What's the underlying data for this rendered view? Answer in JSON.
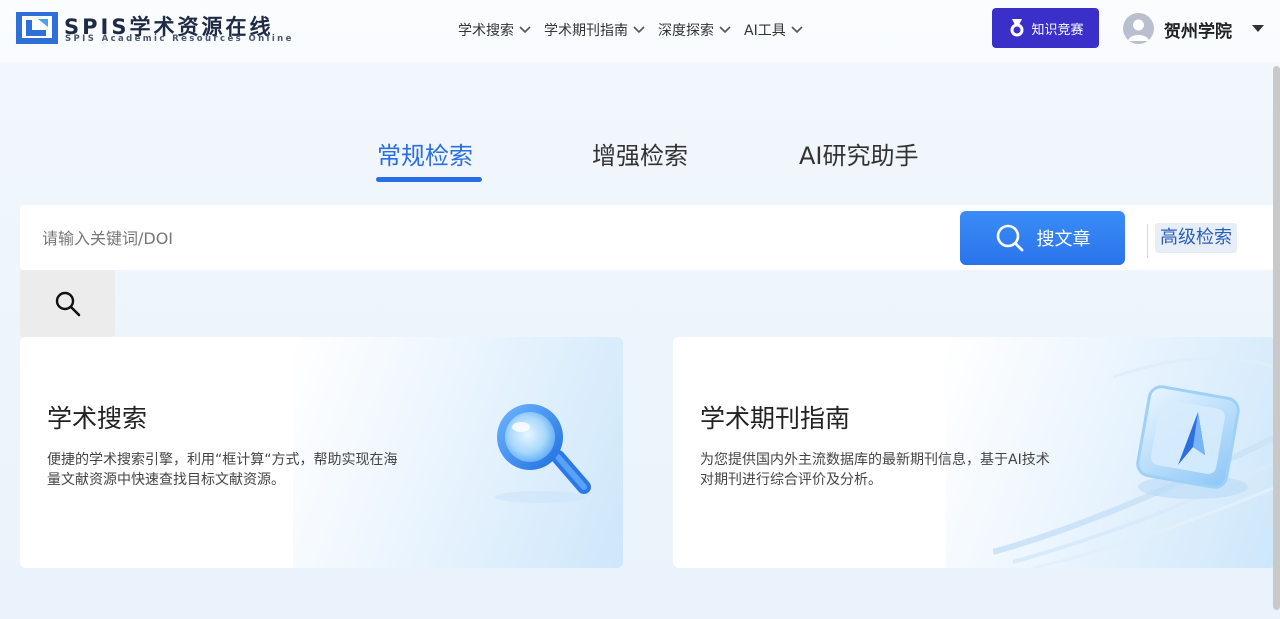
{
  "header": {
    "logo_title": "SPIS学术资源在线",
    "logo_subtitle": "SPIS Academic Resources Online",
    "nav": [
      {
        "label": "学术搜索"
      },
      {
        "label": "学术期刊指南"
      },
      {
        "label": "深度探索"
      },
      {
        "label": "AI工具"
      }
    ],
    "contest_label": "知识竞赛",
    "user_name": "贺州学院"
  },
  "tabs": [
    {
      "label": "常规检索",
      "active": true
    },
    {
      "label": "增强检索",
      "active": false
    },
    {
      "label": "AI研究助手",
      "active": false
    }
  ],
  "search": {
    "placeholder": "请输入关键词/DOI",
    "value": "",
    "button_label": "搜文章",
    "advanced_label": "高级检索"
  },
  "cards": [
    {
      "title": "学术搜索",
      "description": "便捷的学术搜索引擎，利用“框计算“方式，帮助实现在海量文献资源中快速查找目标文献资源。",
      "icon": "magnifier-icon"
    },
    {
      "title": "学术期刊指南",
      "description": "为您提供国内外主流数据库的最新期刊信息，基于AI技术对期刊进行综合评价及分析。",
      "icon": "compass-cube-icon"
    }
  ],
  "colors": {
    "accent": "#2a6ee6",
    "contest_button": "#3b2fc9",
    "search_button": "#3080f0"
  }
}
